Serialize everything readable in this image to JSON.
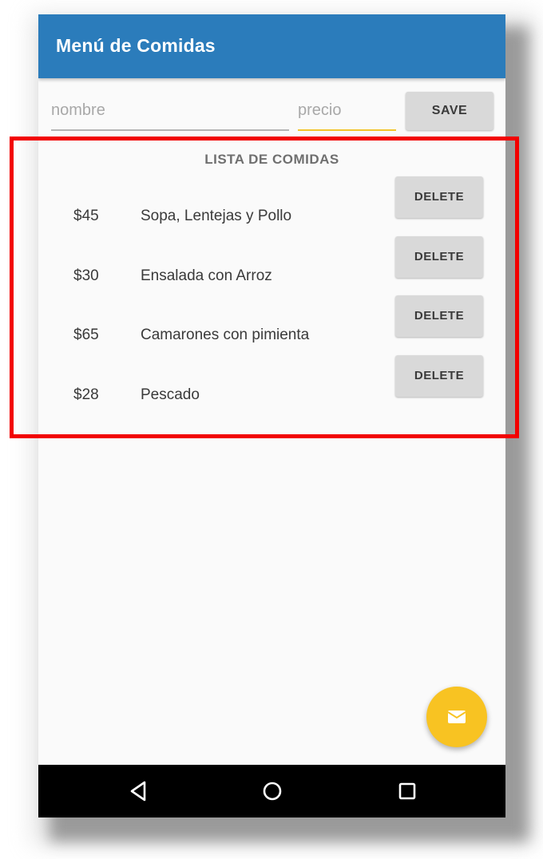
{
  "app": {
    "title": "Menú de Comidas"
  },
  "form": {
    "name_placeholder": "nombre",
    "price_placeholder": "precio",
    "save_label": "SAVE"
  },
  "list": {
    "title": "LISTA DE COMIDAS",
    "items": [
      {
        "price": "$45",
        "name": "Sopa, Lentejas y Pollo",
        "delete_label": "DELETE"
      },
      {
        "price": "$30",
        "name": "Ensalada con Arroz",
        "delete_label": "DELETE"
      },
      {
        "price": "$65",
        "name": "Camarones con pimienta",
        "delete_label": "DELETE"
      },
      {
        "price": "$28",
        "name": "Pescado",
        "delete_label": "DELETE"
      }
    ]
  },
  "fab": {
    "icon": "mail-icon",
    "color": "#f8c322"
  },
  "navigation": {
    "back_icon": "back-triangle-icon",
    "home_icon": "home-circle-icon",
    "recents_icon": "recents-square-icon"
  },
  "colors": {
    "appbar": "#2b7cbb",
    "accent": "#f3c52d",
    "highlight": "#f20000",
    "navbar": "#000000"
  }
}
